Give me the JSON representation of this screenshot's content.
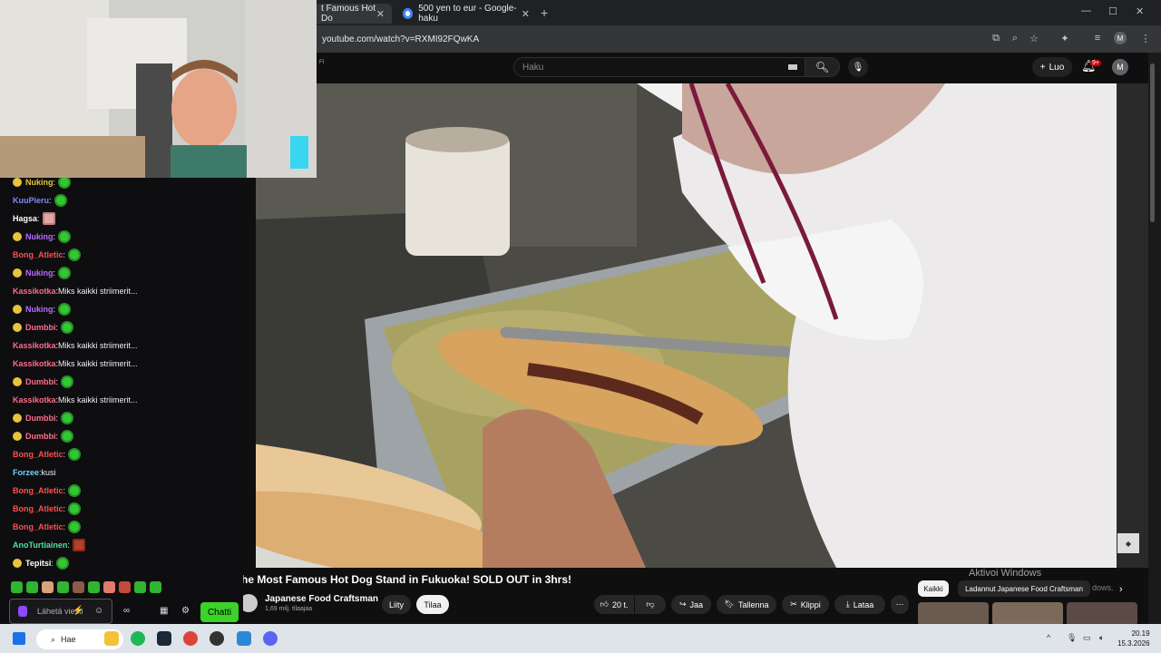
{
  "browser": {
    "tabs": [
      {
        "label": "t Famous Hot Do",
        "active": true
      },
      {
        "label": "500 yen to eur - Google-haku",
        "active": false
      }
    ],
    "new_tab": "+",
    "url": "youtube.com/watch?v=RXMI92FQwKA",
    "profile_initial": "M"
  },
  "youtube": {
    "locale_badge": "FI",
    "search_placeholder": "Haku",
    "create_label": "Luo",
    "notification_count": "9+",
    "avatar_initial": "M",
    "video_title": "he Most Famous Hot Dog Stand in Fukuoka! SOLD OUT in 3hrs!",
    "channel_name": "Japanese Food Craftsman",
    "channel_subs": "1,69 milj. tilaajaa",
    "join_label": "Liity",
    "subscribe_label": "Tilaa",
    "likes": "20 t.",
    "share_label": "Jaa",
    "save_label": "Tallenna",
    "clip_label": "Klippi",
    "download_label": "Lataa",
    "chips": [
      "Kaikki",
      "Ladannut Japanese Food Craftsman"
    ],
    "watermark": "Aktivoi Windows",
    "watermark_sub": "dows."
  },
  "chat": {
    "messages": [
      {
        "user": "Nuking",
        "color": "#e8c33c",
        "text": "",
        "badge": true,
        "emote": "green"
      },
      {
        "user": "KuuPieru",
        "color": "#7b8cff",
        "text": "",
        "badge": false,
        "emote": "green"
      },
      {
        "user": "Hagsa",
        "color": "#ffffff",
        "text": "",
        "badge": false,
        "emote": "pink"
      },
      {
        "user": "Nuking",
        "color": "#b86cff",
        "text": "",
        "badge": true,
        "emote": "green"
      },
      {
        "user": "Bong_Atletic",
        "color": "#ff4f4f",
        "text": "",
        "badge": false,
        "emote": "green"
      },
      {
        "user": "Nuking",
        "color": "#b86cff",
        "text": "",
        "badge": true,
        "emote": "green"
      },
      {
        "user": "Kassikotka",
        "color": "#ff6b8a",
        "text": "Miks kaikki striimerit...",
        "badge": false,
        "emote": ""
      },
      {
        "user": "Nuking",
        "color": "#b86cff",
        "text": "",
        "badge": true,
        "emote": "green"
      },
      {
        "user": "Dumbbi",
        "color": "#ff6b8a",
        "text": "",
        "badge": true,
        "emote": "green"
      },
      {
        "user": "Kassikotka",
        "color": "#ff6b8a",
        "text": "Miks kaikki striimerit...",
        "badge": false,
        "emote": ""
      },
      {
        "user": "Kassikotka",
        "color": "#ff6b8a",
        "text": "Miks kaikki striimerit...",
        "badge": false,
        "emote": ""
      },
      {
        "user": "Dumbbi",
        "color": "#ff6b8a",
        "text": "",
        "badge": true,
        "emote": "green"
      },
      {
        "user": "Kassikotka",
        "color": "#ff6b8a",
        "text": "Miks kaikki striimerit...",
        "badge": false,
        "emote": ""
      },
      {
        "user": "Dumbbi",
        "color": "#ff6b8a",
        "text": "",
        "badge": true,
        "emote": "green"
      },
      {
        "user": "Dumbbi",
        "color": "#ff6b8a",
        "text": "",
        "badge": true,
        "emote": "green"
      },
      {
        "user": "Bong_Atletic",
        "color": "#ff4f4f",
        "text": "",
        "badge": false,
        "emote": "green"
      },
      {
        "user": "Forzee",
        "color": "#6fd1ff",
        "text": "kusi",
        "badge": false,
        "emote": ""
      },
      {
        "user": "Bong_Atletic",
        "color": "#ff4f4f",
        "text": "",
        "badge": false,
        "emote": "green"
      },
      {
        "user": "Bong_Atletic",
        "color": "#ff4f4f",
        "text": "",
        "badge": false,
        "emote": "green"
      },
      {
        "user": "Bong_Atletic",
        "color": "#ff4f4f",
        "text": "",
        "badge": false,
        "emote": "green"
      },
      {
        "user": "AnoTurtiainen",
        "color": "#4fe0a0",
        "text": "",
        "badge": false,
        "emote": "red"
      },
      {
        "user": "Tepitsi",
        "color": "#ffffff",
        "text": "",
        "badge": true,
        "emote": "green"
      }
    ],
    "input_placeholder": "Lähetä viesti",
    "chat_button": "Chatti"
  },
  "taskbar": {
    "search_label": "Hae",
    "time": "20.19",
    "date": "15.3.2026"
  }
}
